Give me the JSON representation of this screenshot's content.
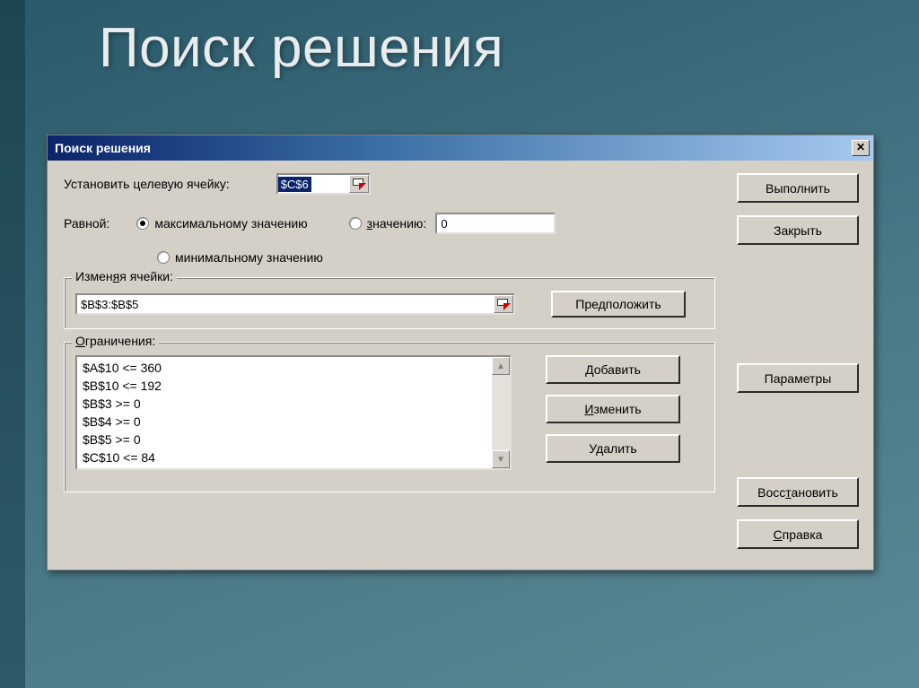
{
  "slide": {
    "title": "Поиск решения"
  },
  "dialog": {
    "title": "Поиск решения",
    "target_label": "Установить целевую ячейку:",
    "target_cell": "$C$6",
    "equal_label": "Равной:",
    "opt_max": "максимальному значению",
    "opt_min": "минимальному значению",
    "opt_val_prefix": "значению:",
    "opt_val_underline": "з",
    "value_input": "0",
    "changing_legend": "Изменяя ячейки:",
    "changing_cells": "$B$3:$B$5",
    "guess_btn": "Предположить",
    "constraints_legend": "Ограничения:",
    "constraints_underline": "О",
    "constraints": [
      "$A$10 <= 360",
      "$B$10 <= 192",
      "$B$3 >= 0",
      "$B$4 >= 0",
      "$B$5 >= 0",
      "$C$10 <= 84"
    ],
    "add_btn": "Добавить",
    "add_underline": "Д",
    "change_btn": "Изменить",
    "change_underline": "И",
    "delete_btn": "Удалить",
    "buttons": {
      "run": "Выполнить",
      "close": "Закрыть",
      "params": "Параметры",
      "reset": "Восстановить",
      "reset_underline": "т",
      "help": "Справка",
      "help_underline": "С"
    }
  }
}
